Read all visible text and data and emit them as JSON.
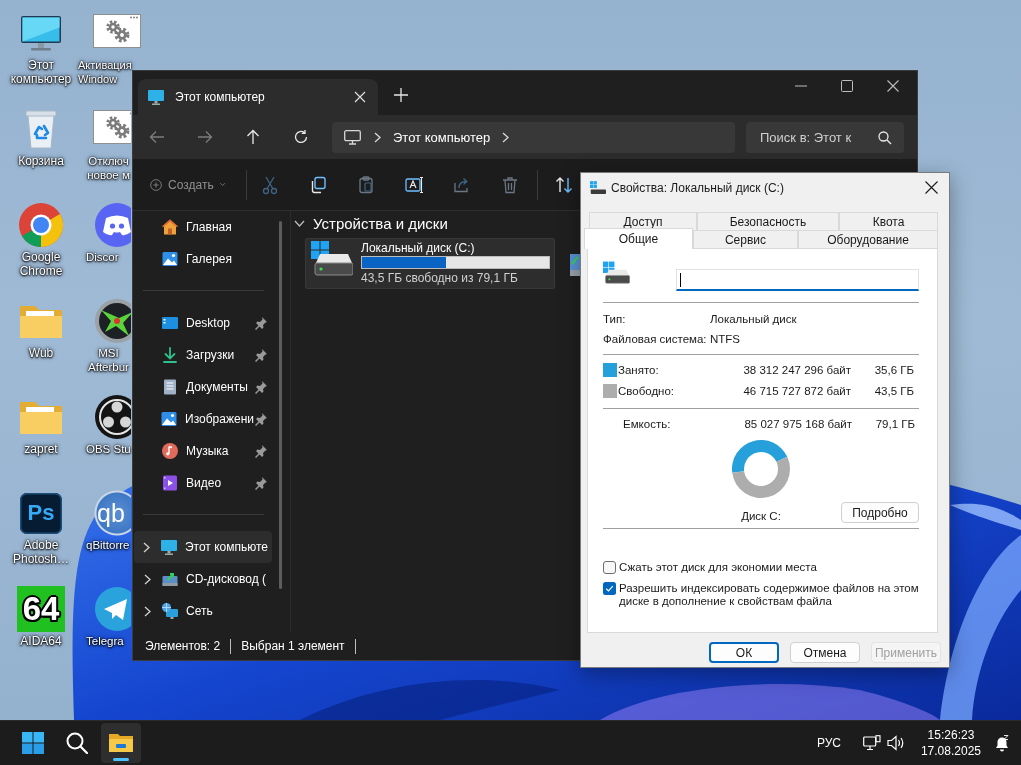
{
  "desktop": {
    "icon_columns": [
      {
        "icons": [
          {
            "label": "Этот компьютер",
            "kind": "computer"
          },
          {
            "label": "Корзина",
            "kind": "recycle-bin"
          },
          {
            "label": "Google Chrome",
            "kind": "chrome"
          },
          {
            "label": "Wub",
            "kind": "folder"
          },
          {
            "label": "zapret",
            "kind": "folder"
          },
          {
            "label": "Adobe Photosh…",
            "kind": "photoshop",
            "logo_text": "Ps"
          },
          {
            "label": "AIDA64",
            "kind": "aida",
            "logo_text": "64"
          }
        ]
      },
      {
        "icons": [
          {
            "label": "Активация Window",
            "kind": "settings-shortcut"
          },
          {
            "label": "Отключ новое м",
            "kind": "settings-shortcut"
          },
          {
            "label": "Discor",
            "kind": "discord"
          },
          {
            "label": "MSI Afterbur",
            "kind": "msi"
          },
          {
            "label": "OBS Stu",
            "kind": "obs"
          },
          {
            "label": "qBittorre",
            "kind": "qbittorrent",
            "logo_text": "qb"
          },
          {
            "label": "Telegra",
            "kind": "telegram"
          }
        ]
      }
    ]
  },
  "explorer": {
    "tabs": [
      {
        "title": "Этот компьютер",
        "selected": true
      }
    ],
    "address": {
      "segments": [
        "Этот компьютер"
      ]
    },
    "search": {
      "placeholder": "Поиск в: Этот к"
    },
    "toolbar": [
      {
        "kind": "new",
        "label": "Создать",
        "disabled": true
      },
      {
        "kind": "cut",
        "disabled": true
      },
      {
        "kind": "copy",
        "disabled": false
      },
      {
        "kind": "paste",
        "disabled": true
      },
      {
        "kind": "rename",
        "disabled": false
      },
      {
        "kind": "share",
        "disabled": true
      },
      {
        "kind": "delete",
        "disabled": true
      },
      {
        "kind": "sort",
        "disabled": false
      }
    ],
    "nav_groups": [
      {
        "items": [
          {
            "label": "Главная",
            "kind": "home",
            "selected": false
          },
          {
            "label": "Галерея",
            "kind": "gallery",
            "selected": false
          }
        ]
      },
      {
        "items": [
          {
            "label": "Desktop",
            "kind": "desktop",
            "selected": false,
            "pinned": true
          },
          {
            "label": "Загрузки",
            "kind": "downloads",
            "selected": false,
            "pinned": true
          },
          {
            "label": "Документы",
            "kind": "documents",
            "selected": false,
            "pinned": true
          },
          {
            "label": "Изображени",
            "kind": "pictures",
            "selected": false,
            "pinned": true
          },
          {
            "label": "Музыка",
            "kind": "music",
            "selected": false,
            "pinned": true
          },
          {
            "label": "Видео",
            "kind": "video",
            "selected": false,
            "pinned": true
          }
        ]
      },
      {
        "items": [
          {
            "label": "Этот компьюте",
            "kind": "computer",
            "selected": true,
            "expanded": false
          },
          {
            "label": "CD-дисковод (",
            "kind": "cd",
            "selected": false,
            "expanded": false
          },
          {
            "label": "Сеть",
            "kind": "network",
            "selected": false,
            "expanded": false
          }
        ]
      }
    ],
    "section": {
      "title": "Устройства и диски",
      "expanded": true,
      "drives": [
        {
          "kind": "system",
          "name": "Локальный диск (C:)",
          "level": 0.45,
          "info": "43,5 ГБ свободно из 79,1 ГБ",
          "selected": true
        },
        {
          "kind": "cd",
          "selected": false
        }
      ]
    },
    "status_bar": [
      "Элементов: 2",
      "Выбран 1 элемент"
    ]
  },
  "properties_dialog": {
    "title": "Свойства: Локальный диск (C:)",
    "tab_rows": [
      [
        {
          "label": "Доступ",
          "selected": false
        },
        {
          "label": "Безопасность",
          "selected": false
        },
        {
          "label": "Квота",
          "selected": false
        }
      ],
      [
        {
          "label": "Общие",
          "selected": true
        },
        {
          "label": "Сервис",
          "selected": false
        },
        {
          "label": "Оборудование",
          "selected": false
        }
      ]
    ],
    "name_field": {
      "focused": true
    },
    "info": [
      {
        "label": "Тип:",
        "value": "Локальный диск"
      },
      {
        "label": "Файловая система:",
        "value": "NTFS"
      }
    ],
    "usage": [
      {
        "label": "Занято:",
        "bytes": "38 312 247 296 байт",
        "size": "35,6 ГБ",
        "color": "#26a0da"
      },
      {
        "label": "Свободно:",
        "bytes": "46 715 727 872 байт",
        "size": "43,5 ГБ",
        "color": "#adadad"
      }
    ],
    "capacity": {
      "label": "Емкость:",
      "bytes": "85 027 975 168 байт",
      "size": "79,1 ГБ"
    },
    "chart_data": {
      "type": "donut",
      "values": [
        45.1,
        54.9
      ]
    },
    "disk_label": "Диск C:",
    "details_button": "Подробно",
    "options": [
      {
        "label": "Сжать этот диск для экономии места",
        "checked": false
      },
      {
        "label": "Разрешить индексировать содержимое файлов на этом диске в дополнение к свойствам файла",
        "checked": true
      }
    ],
    "buttons": [
      {
        "label": "ОК",
        "default": true,
        "disabled": false
      },
      {
        "label": "Отмена",
        "default": false,
        "disabled": false
      },
      {
        "label": "Применить",
        "default": false,
        "disabled": true
      }
    ]
  },
  "taskbar": {
    "apps": [
      {
        "kind": "start",
        "active": false
      },
      {
        "kind": "search",
        "active": false
      },
      {
        "kind": "explorer",
        "active": true
      }
    ],
    "language": "РУС",
    "time": "15:26:23",
    "date": "17.08.2025"
  }
}
